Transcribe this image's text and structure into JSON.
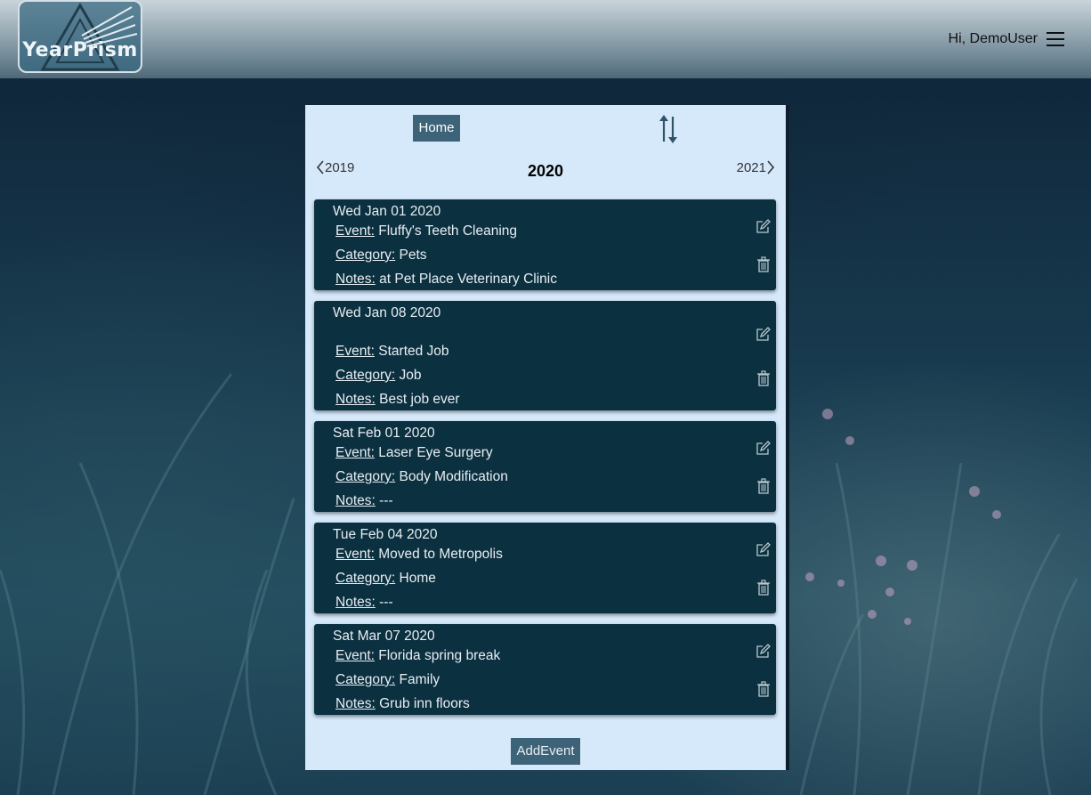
{
  "header": {
    "logo_text": "YearPrism",
    "greeting": "Hi, DemoUser"
  },
  "panel": {
    "home_label": "Home",
    "prev_year": "2019",
    "current_year": "2020",
    "next_year": "2021",
    "add_event_label": "AddEvent",
    "labels": {
      "event": "Event:",
      "category": "Category:",
      "notes": "Notes:"
    }
  },
  "events": [
    {
      "date": "Wed Jan 01 2020",
      "event": "Fluffy's Teeth Cleaning",
      "category": "Pets",
      "notes": "at Pet Place Veterinary Clinic"
    },
    {
      "date": "Wed Jan 08 2020",
      "event": "Started Job",
      "category": "Job",
      "notes": "Best job ever"
    },
    {
      "date": "Sat Feb 01 2020",
      "event": "Laser Eye Surgery",
      "category": "Body Modification",
      "notes": "---"
    },
    {
      "date": "Tue Feb 04 2020",
      "event": "Moved to Metropolis",
      "category": "Home",
      "notes": "---"
    },
    {
      "date": "Sat Mar 07 2020",
      "event": "Florida spring break",
      "category": "Family",
      "notes": "Grub inn floors"
    }
  ],
  "icons": {
    "menu": "hamburger-icon",
    "sort": "sort-icon",
    "prev": "chevron-left-icon",
    "next": "chevron-right-icon",
    "edit": "edit-icon",
    "delete": "trash-icon"
  },
  "colors": {
    "panel_bg": "#d6e9fb",
    "card_bg": "#0b3040",
    "button_bg": "#3c6377"
  }
}
